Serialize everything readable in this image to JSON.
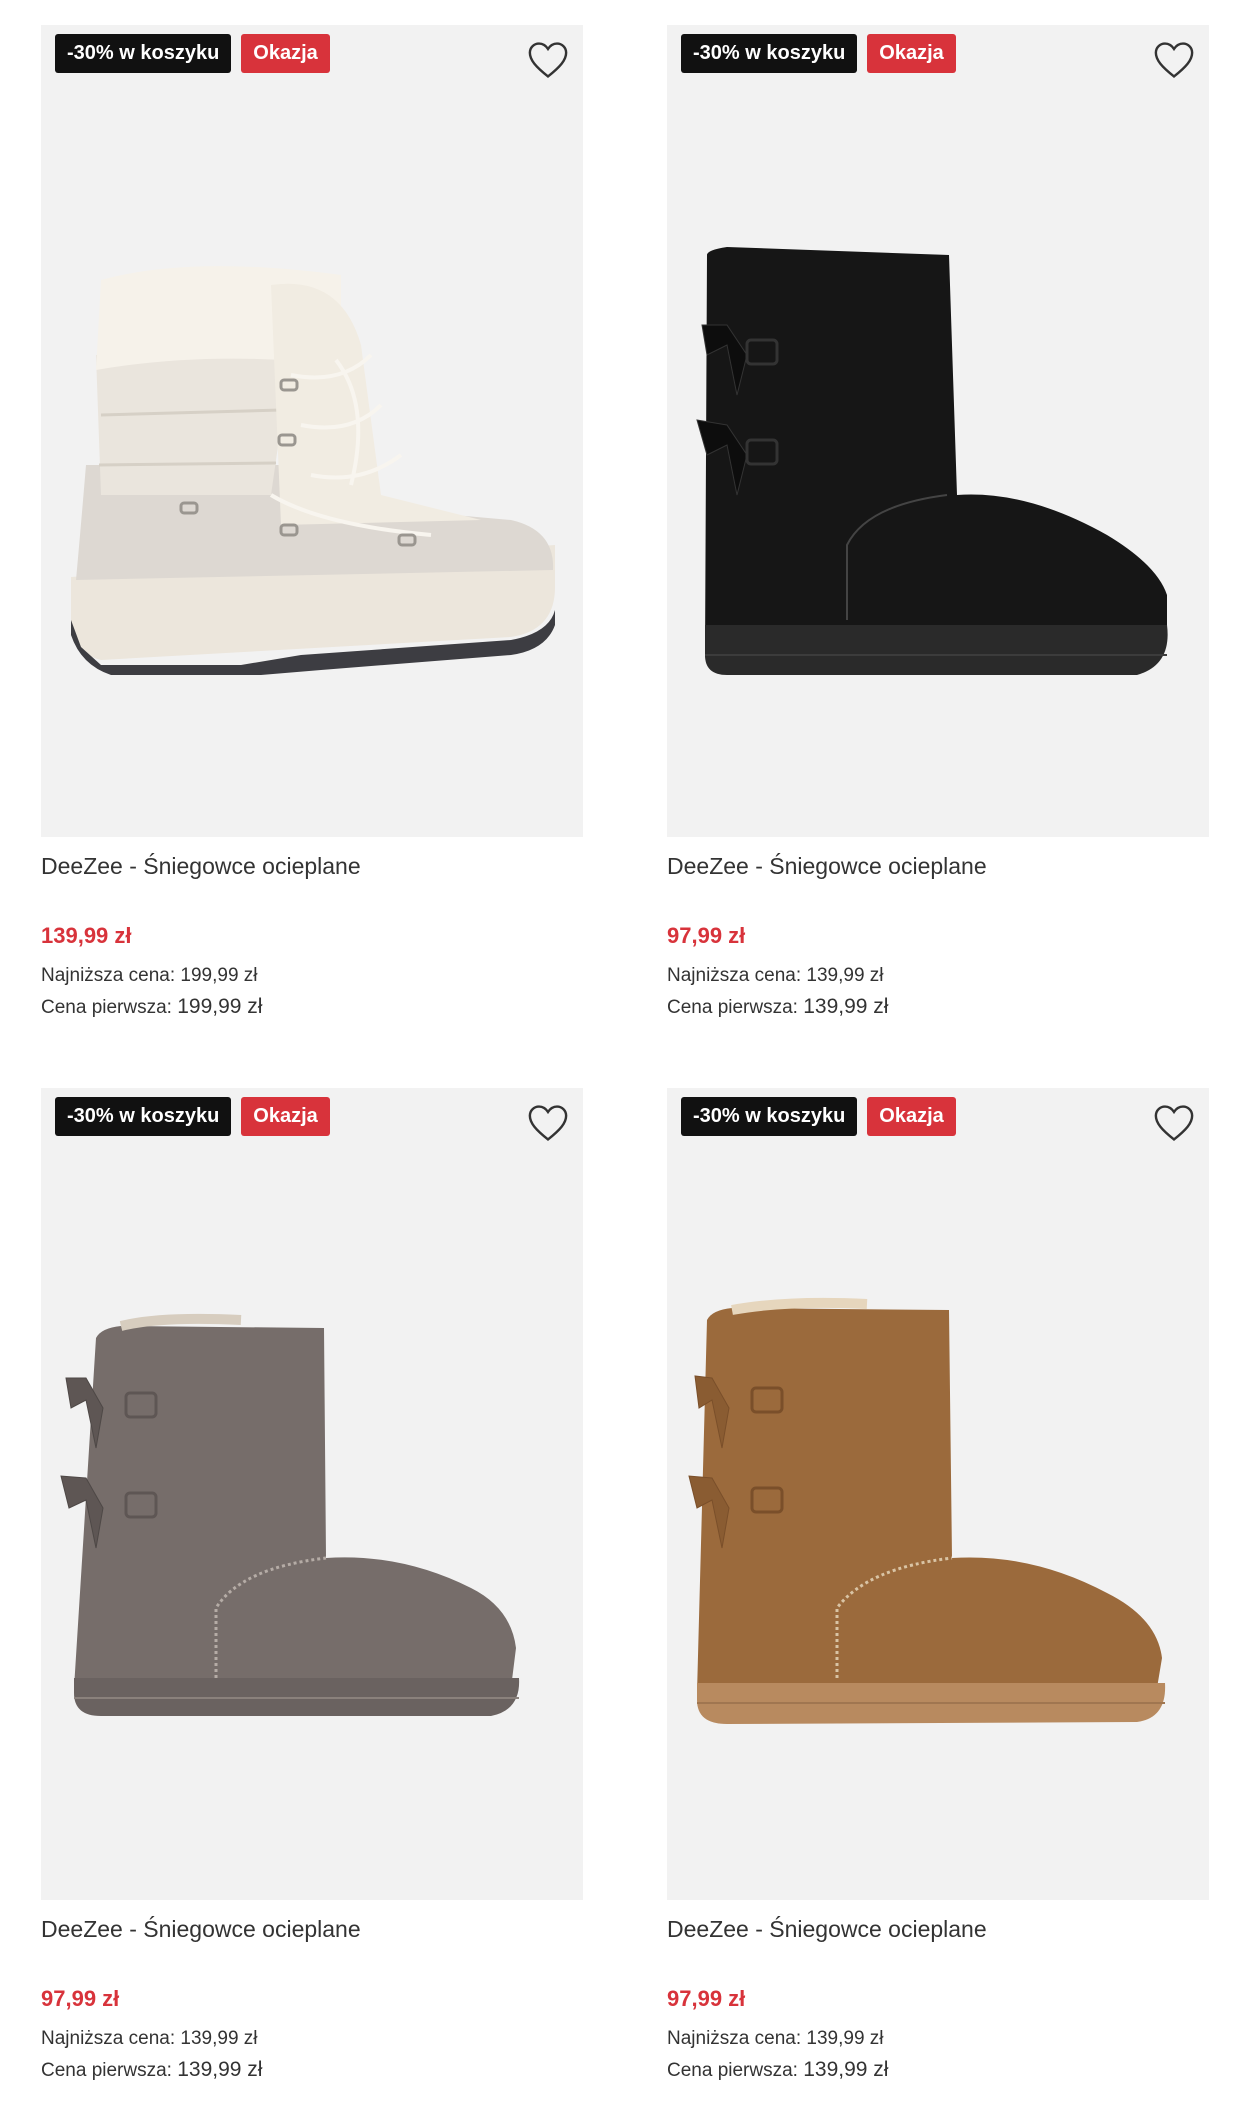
{
  "products": [
    {
      "badge_discount": "-30% w koszyku",
      "badge_deal": "Okazja",
      "title": "DeeZee - Śniegowce ocieplane",
      "price": "139,99 zł",
      "lowest_label": "Najniższa cena:",
      "lowest_value": "199,99 zł",
      "first_label": "Cena pierwsza:",
      "first_value": "199,99 zł",
      "image": "cream-lace-up-snow-boot"
    },
    {
      "badge_discount": "-30% w koszyku",
      "badge_deal": "Okazja",
      "title": "DeeZee - Śniegowce ocieplane",
      "price": "97,99 zł",
      "lowest_label": "Najniższa cena:",
      "lowest_value": "139,99 zł",
      "first_label": "Cena pierwsza:",
      "first_value": "139,99 zł",
      "image": "black-bow-snow-boot"
    },
    {
      "badge_discount": "-30% w koszyku",
      "badge_deal": "Okazja",
      "title": "DeeZee - Śniegowce ocieplane",
      "price": "97,99 zł",
      "lowest_label": "Najniższa cena:",
      "lowest_value": "139,99 zł",
      "first_label": "Cena pierwsza:",
      "first_value": "139,99 zł",
      "image": "grey-bow-snow-boot"
    },
    {
      "badge_discount": "-30% w koszyku",
      "badge_deal": "Okazja",
      "title": "DeeZee - Śniegowce ocieplane",
      "price": "97,99 zł",
      "lowest_label": "Najniższa cena:",
      "lowest_value": "139,99 zł",
      "first_label": "Cena pierwsza:",
      "first_value": "139,99 zł",
      "image": "camel-bow-snow-boot"
    }
  ],
  "colors": {
    "price": "#d8333b",
    "badge_dark": "#111111",
    "badge_red": "#d8333b",
    "image_bg": "#f2f2f2"
  }
}
